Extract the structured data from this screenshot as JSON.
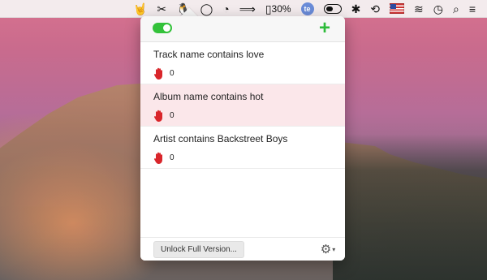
{
  "menubar": {
    "items": [
      {
        "name": "rock-hand-icon",
        "glyph": "🤘"
      },
      {
        "name": "scissors-icon",
        "glyph": "✂"
      },
      {
        "name": "qq-penguin-icon",
        "glyph": "🐧"
      },
      {
        "name": "circle-icon",
        "glyph": "◯"
      },
      {
        "name": "speedometer-icon",
        "glyph": "◔"
      },
      {
        "name": "arrows-icon",
        "glyph": "⟹"
      }
    ],
    "battery_percent": "30%",
    "te_label": "te",
    "bluetooth_glyph": "✱",
    "history_glyph": "⟲",
    "wifi_glyph": "≋",
    "clock_glyph": "◷",
    "search_glyph": "⌕",
    "menu_glyph": "≡"
  },
  "popover": {
    "header": {
      "add_symbol": "+"
    },
    "rules": [
      {
        "title": "Track name contains love",
        "count": "0"
      },
      {
        "title": "Album name contains hot",
        "count": "0"
      },
      {
        "title": "Artist contains Backstreet Boys",
        "count": "0"
      }
    ],
    "footer": {
      "unlock_label": "Unlock Full Version...",
      "gear_glyph": "⚙",
      "caret_glyph": "▾"
    }
  },
  "colors": {
    "accent_green": "#2dbb3a",
    "selected_row": "#fbe7ea",
    "hand_red": "#d9262b"
  }
}
